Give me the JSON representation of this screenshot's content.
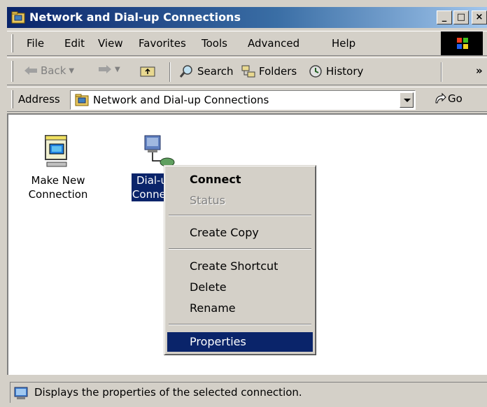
{
  "window": {
    "title": "Network and Dial-up Connections",
    "controls": {
      "minimize": "_",
      "maximize": "□",
      "close": "×"
    }
  },
  "menubar": {
    "items": [
      "File",
      "Edit",
      "View",
      "Favorites",
      "Tools",
      "Advanced",
      "Help"
    ],
    "overflow": "»"
  },
  "toolbar": {
    "back": "Back",
    "search": "Search",
    "folders": "Folders",
    "history": "History"
  },
  "addressbar": {
    "label": "Address",
    "value": "Network and Dial-up Connections",
    "go": "Go"
  },
  "content": {
    "items": [
      {
        "label_line1": "Make New",
        "label_line2": "Connection",
        "icon": "make-new-connection-icon"
      },
      {
        "label_line1": "Dial-u",
        "label_line2": "Connec",
        "icon": "dialup-connection-icon",
        "selected": true
      }
    ]
  },
  "context_menu": {
    "items": [
      "Connect",
      "Status",
      "Create Copy",
      "Create Shortcut",
      "Delete",
      "Rename",
      "Properties"
    ],
    "default_item": "Connect",
    "disabled_item": "Status",
    "highlighted_item": "Properties"
  },
  "statusbar": {
    "text": "Displays the properties of the selected connection."
  },
  "colors": {
    "titlebar_start": "#0a246a",
    "titlebar_end": "#a6caf0",
    "selection": "#0a246a",
    "face": "#d4d0c8"
  }
}
